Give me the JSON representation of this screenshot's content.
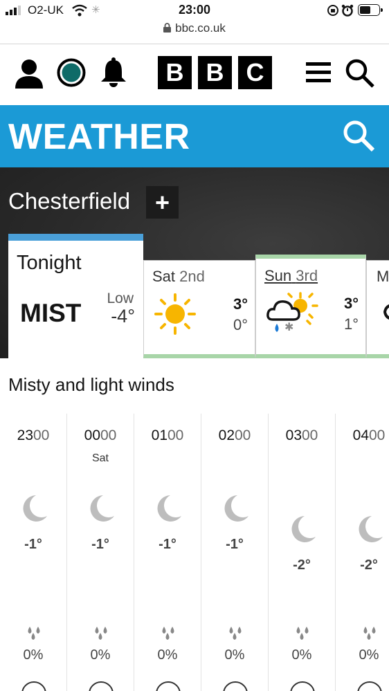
{
  "status_bar": {
    "carrier": "O2-UK",
    "time": "23:00"
  },
  "browser": {
    "url": "bbc.co.uk"
  },
  "bbc_header": {
    "logo_letters": [
      "B",
      "B",
      "C"
    ]
  },
  "weather_bar": {
    "title": "WEATHER"
  },
  "location": {
    "name": "Chesterfield",
    "add_label": "+"
  },
  "tonight": {
    "label": "Tonight",
    "condition": "MIST",
    "low_label": "Low",
    "low_value": "-4°"
  },
  "days": [
    {
      "day": "Sat",
      "date": "2nd",
      "high": "3°",
      "low": "0°",
      "icon": "sun-icon"
    },
    {
      "day": "Sun",
      "date": "3rd",
      "high": "3°",
      "low": "1°",
      "icon": "cloud-sleet-sun-icon"
    },
    {
      "day": "M"
    }
  ],
  "summary": "Misty and light winds",
  "hourly": [
    {
      "hh": "23",
      "mm": "00",
      "day": "",
      "temp": "-1°",
      "rain": "0%",
      "icon": "moon-icon"
    },
    {
      "hh": "00",
      "mm": "00",
      "day": "Sat",
      "temp": "-1°",
      "rain": "0%",
      "icon": "moon-icon"
    },
    {
      "hh": "01",
      "mm": "00",
      "day": "",
      "temp": "-1°",
      "rain": "0%",
      "icon": "moon-icon"
    },
    {
      "hh": "02",
      "mm": "00",
      "day": "",
      "temp": "-1°",
      "rain": "0%",
      "icon": "moon-icon"
    },
    {
      "hh": "03",
      "mm": "00",
      "day": "",
      "temp": "-2°",
      "rain": "0%",
      "icon": "moon-icon"
    },
    {
      "hh": "04",
      "mm": "00",
      "day": "",
      "temp": "-2°",
      "rain": "0%",
      "icon": "moon-icon"
    }
  ],
  "colors": {
    "weather_blue": "#1b9ad6",
    "tonight_accent": "#4a9fd8",
    "day_accent": "#a8d5a8",
    "sun_yellow": "#f7b500"
  }
}
